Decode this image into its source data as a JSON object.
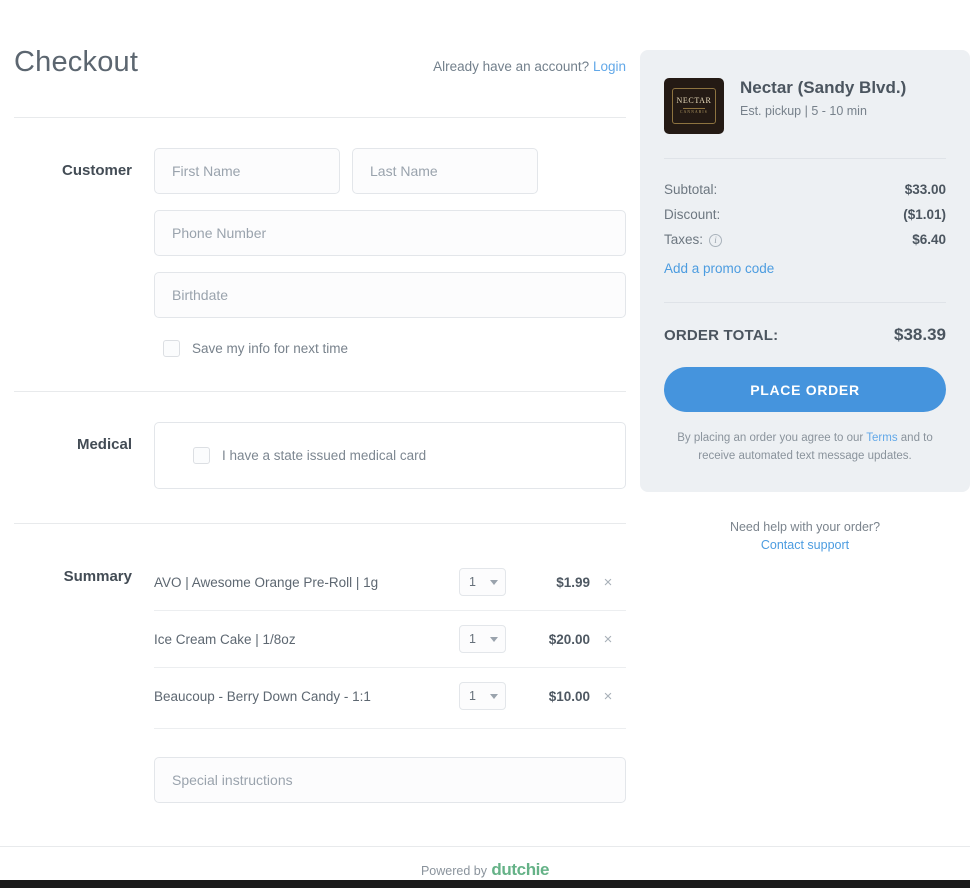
{
  "header": {
    "title": "Checkout",
    "account_prompt": "Already have an account?",
    "login_label": "Login"
  },
  "customer": {
    "section_label": "Customer",
    "first_name_placeholder": "First Name",
    "first_name_value": "",
    "last_name_placeholder": "Last Name",
    "last_name_value": "",
    "phone_placeholder": "Phone Number",
    "phone_value": "",
    "birthdate_placeholder": "Birthdate",
    "birthdate_value": "",
    "save_info_label": "Save my info for next time",
    "save_info_checked": false
  },
  "medical": {
    "section_label": "Medical",
    "card_label": "I have a state issued medical card",
    "card_checked": false
  },
  "summary": {
    "section_label": "Summary",
    "items": [
      {
        "name": "AVO | Awesome Orange Pre-Roll | 1g",
        "qty": "1",
        "price": "$1.99",
        "remove": "×"
      },
      {
        "name": "Ice Cream Cake | 1/8oz",
        "qty": "1",
        "price": "$20.00",
        "remove": "×"
      },
      {
        "name": "Beaucoup - Berry Down Candy - 1:1",
        "qty": "1",
        "price": "$10.00",
        "remove": "×"
      }
    ],
    "special_instructions_placeholder": "Special instructions",
    "special_instructions_value": ""
  },
  "order": {
    "store_name": "Nectar (Sandy Blvd.)",
    "store_pickup": "Est. pickup | 5 - 10 min",
    "logo_line1": "NECTAR",
    "logo_line2": "CANNABIS",
    "subtotal_label": "Subtotal:",
    "subtotal_value": "$33.00",
    "discount_label": "Discount:",
    "discount_value": "($1.01)",
    "taxes_label": "Taxes:",
    "taxes_value": "$6.40",
    "taxes_info_glyph": "i",
    "promo_label": "Add a promo code",
    "total_label": "ORDER TOTAL:",
    "total_value": "$38.39",
    "place_order_label": "PLACE ORDER",
    "terms_before": "By placing an order you agree to our",
    "terms_link": "Terms",
    "terms_after": "and to receive automated text message updates."
  },
  "support": {
    "question": "Need help with your order?",
    "link": "Contact support"
  },
  "footer": {
    "powered_by": "Powered by",
    "brand": "dutchie"
  },
  "colors": {
    "accent_blue": "#4594dd",
    "link_blue": "#4c9ce0",
    "panel_bg": "#edf0f3",
    "brand_green": "#65b287",
    "text_dark": "#4b555f",
    "text_muted": "#7b848d"
  }
}
